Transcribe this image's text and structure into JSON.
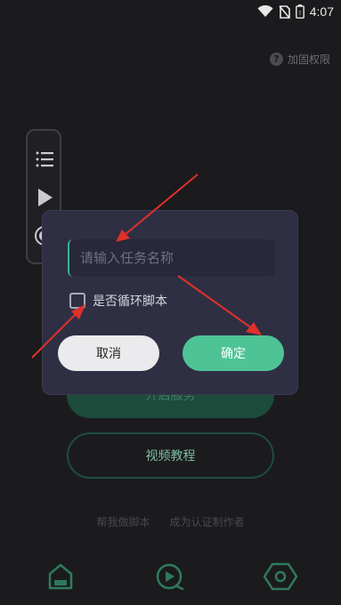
{
  "status_bar": {
    "time": "4:07",
    "icons": [
      "wifi-icon",
      "no-sim-icon",
      "battery-icon"
    ]
  },
  "permission": {
    "label": "加固权限",
    "icon": "help-circle-icon"
  },
  "float_panel": {
    "icons": [
      "list-icon",
      "play-icon",
      "record-icon"
    ]
  },
  "main": {
    "start_service_label": "开启服务",
    "video_tutorial_label": "视频教程"
  },
  "links": {
    "help_write": "帮我做脚本",
    "become_author": "成为认证制作者"
  },
  "bottom_nav": {
    "items": [
      "home-icon",
      "video-play-icon",
      "settings-hex-icon"
    ]
  },
  "dialog": {
    "input_placeholder": "请输入任务名称",
    "input_value": "",
    "loop_label": "是否循环脚本",
    "loop_checked": false,
    "cancel_label": "取消",
    "confirm_label": "确定"
  },
  "colors": {
    "accent": "#4ec496",
    "annotation_arrow": "#e0302a",
    "dialog_bg": "#2f2f44",
    "background": "#1b1b1e"
  }
}
